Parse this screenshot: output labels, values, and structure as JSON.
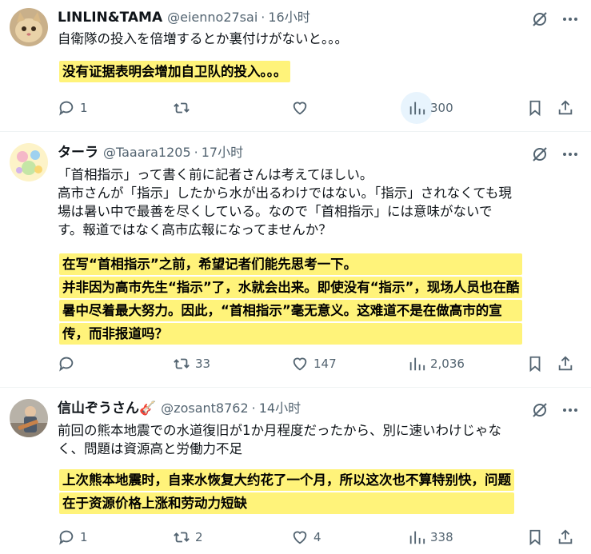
{
  "tweets": [
    {
      "name": "LINLIN&TAMA",
      "handle": "@eienno27sai",
      "time": "16小时",
      "text": [
        "自衛隊の投入を倍増するとか裏付けがないと。。。"
      ],
      "translation": [
        "没有证据表明会增加自卫队的投入。。。"
      ],
      "replies": "1",
      "retweets": "",
      "likes": "",
      "views": "300"
    },
    {
      "name": "ターラ",
      "handle": "@Taaara1205",
      "time": "17小时",
      "text": [
        "「首相指示」って書く前に記者さんは考えてほしい。",
        "高市さんが「指示」したから水が出るわけではない。「指示」されなくても現",
        "場は暑い中で最善を尽くしている。なので「首相指示」には意味がないで",
        "す。報道ではなく高市広報になってませんか？"
      ],
      "translation": [
        "在写“首相指示”之前，希望记者们能先思考一下。",
        "并非因为高市先生“指示”了，水就会出来。即使没有“指示”，现场人员也在酷",
        "暑中尽着最大努力。因此，“首相指示”毫无意义。这难道不是在做高市的宣",
        "传，而非报道吗？"
      ],
      "replies": "",
      "retweets": "33",
      "likes": "147",
      "views": "2,036"
    },
    {
      "name": "信山ぞうさん🎸",
      "handle": "@zosant8762",
      "time": "14小时",
      "text": [
        "前回の熊本地震での水道復旧が1か月程度だったから、別に速いわけじゃな",
        "く、問題は資源高と労働力不足"
      ],
      "translation": [
        "上次熊本地震时，自来水恢复大约花了一个月，所以这次也不算特别快，问题",
        "在于资源价格上涨和劳动力短缺"
      ],
      "replies": "1",
      "retweets": "2",
      "likes": "4",
      "views": "338"
    }
  ],
  "colors": {
    "highlight": "#fff37a",
    "muted": "#536471",
    "text": "#0f1419"
  },
  "icons": [
    "reply-icon",
    "retweet-icon",
    "like-icon",
    "views-icon",
    "bookmark-icon",
    "share-icon",
    "mute-icon",
    "more-icon"
  ]
}
